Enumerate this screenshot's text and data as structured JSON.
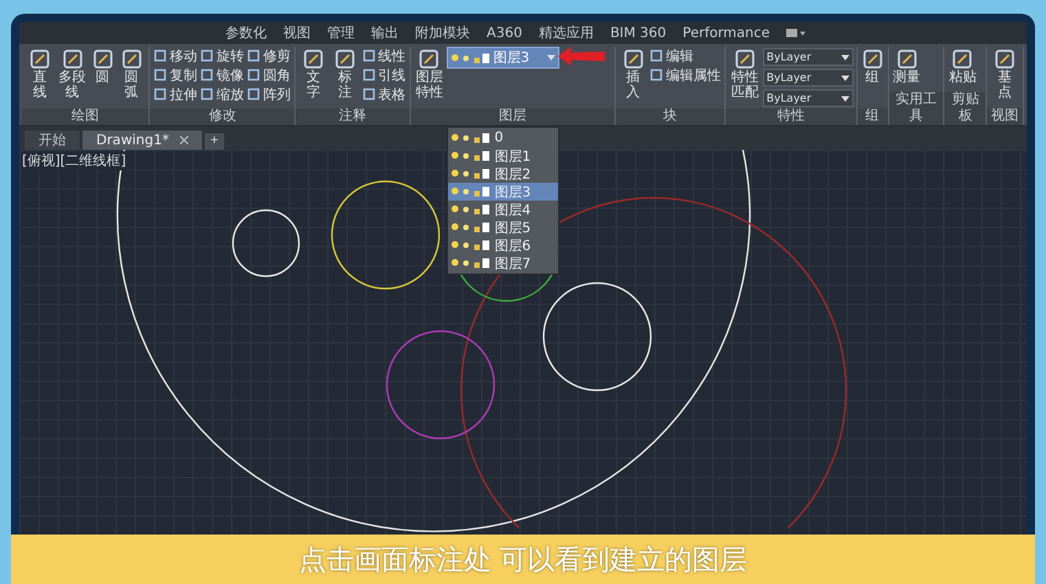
{
  "ribbon_tabs": [
    {
      "label": "参数化"
    },
    {
      "label": "视图"
    },
    {
      "label": "管理"
    },
    {
      "label": "输出"
    },
    {
      "label": "附加模块"
    },
    {
      "label": "A360"
    },
    {
      "label": "精选应用"
    },
    {
      "label": "BIM 360"
    },
    {
      "label": "Performance"
    }
  ],
  "panels": [
    {
      "title": "绘图",
      "large": [
        "直线",
        "多段线",
        "圆",
        "圆弧"
      ]
    },
    {
      "title": "修改",
      "small": [
        "移动",
        "旋转",
        "修剪",
        "复制",
        "镜像",
        "圆角",
        "拉伸",
        "缩放",
        "阵列"
      ]
    },
    {
      "title": "注释",
      "large": [
        "文字",
        "标注"
      ],
      "small": [
        "线性",
        "引线",
        "表格"
      ]
    },
    {
      "title": "图层",
      "large": [
        "图层特性"
      ],
      "layer_select": "图层3"
    },
    {
      "title": "块",
      "large": [
        "插入"
      ],
      "small": [
        "编辑",
        "编辑属性"
      ]
    },
    {
      "title": "特性",
      "large": [
        "特性匹配"
      ],
      "selects": [
        "ByLayer",
        "ByLayer",
        "ByLayer"
      ]
    },
    {
      "title": "组",
      "large": [
        "组"
      ]
    },
    {
      "title": "实用工具",
      "large": [
        "测量"
      ]
    },
    {
      "title": "剪贴板",
      "large": [
        "粘贴"
      ]
    },
    {
      "title": "视图",
      "large": [
        "基点"
      ]
    }
  ],
  "layer_list": [
    {
      "name": "0",
      "selected": false
    },
    {
      "name": "图层1",
      "selected": false
    },
    {
      "name": "图层2",
      "selected": false
    },
    {
      "name": "图层3",
      "selected": true
    },
    {
      "name": "图层4",
      "selected": false
    },
    {
      "name": "图层5",
      "selected": false
    },
    {
      "name": "图层6",
      "selected": false
    },
    {
      "name": "图层7",
      "selected": false
    }
  ],
  "doc_tabs": [
    {
      "label": "开始",
      "selected": false
    },
    {
      "label": "Drawing1*",
      "selected": true
    }
  ],
  "new_tab": "+",
  "viewport_label": "[俯视][二维线框]",
  "caption": "点击画面标注处 可以看到建立的图层"
}
